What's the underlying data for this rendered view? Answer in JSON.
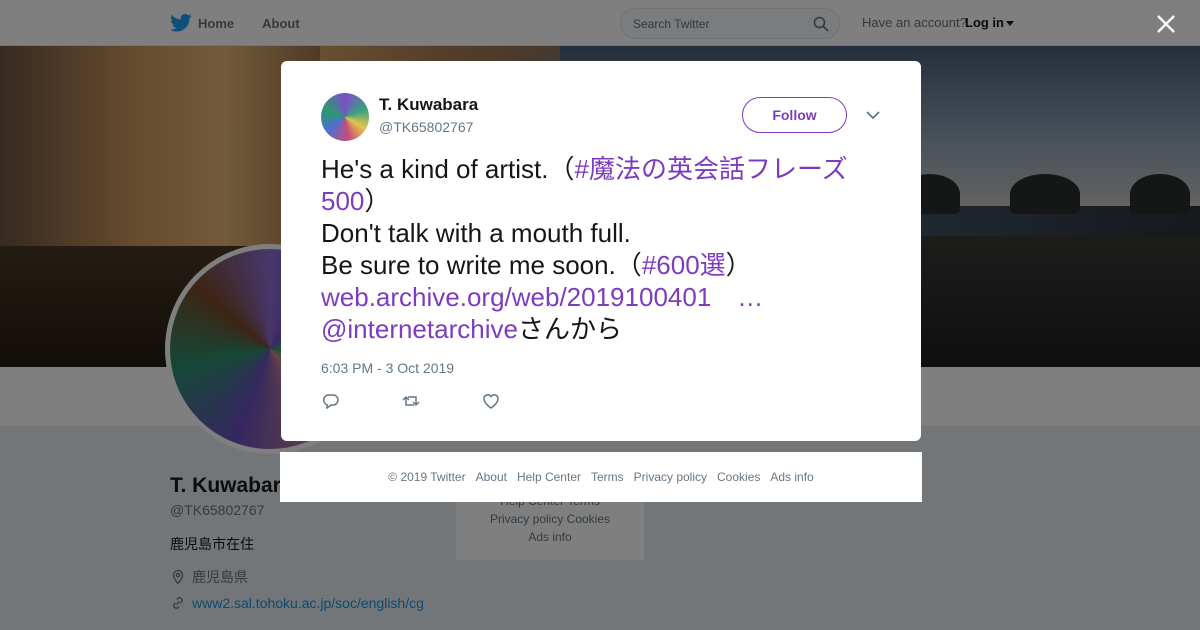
{
  "nav": {
    "home": "Home",
    "about": "About",
    "search_placeholder": "Search Twitter",
    "account_prompt": "Have an account?",
    "login": "Log in"
  },
  "profile": {
    "name": "T. Kuwabara",
    "handle": "@TK65802767",
    "bio": "鹿児島市在住",
    "location": "鹿児島県",
    "link": "www2.sal.tohoku.ac.jp/soc/english/cg",
    "more": "..."
  },
  "mini_footer": {
    "line1": "Help Center   Terms",
    "line2": "Privacy policy   Cookies",
    "line3": "Ads info"
  },
  "tweet": {
    "name": "T. Kuwabara",
    "handle": "@TK65802767",
    "follow": "Follow",
    "line1_text": "He's a kind of artist.（",
    "line1_tag": "#魔法の英会話フレーズ500",
    "line1_end": "）",
    "line2": "Don't talk with a mouth full.",
    "line3_text": "Be sure to write me soon.（",
    "line3_tag": "#600選",
    "line3_end": "）",
    "line4_link": "web.archive.org/web/2019100401　…",
    "line5_mention": "@internetarchive",
    "line5_end": "さんから",
    "timestamp": "6:03 PM - 3 Oct 2019"
  },
  "footer": {
    "items": [
      "© 2019 Twitter",
      "About",
      "Help Center",
      "Terms",
      "Privacy policy",
      "Cookies",
      "Ads info"
    ]
  },
  "colors": {
    "accent": "#7d3cbf",
    "twitter_blue": "#1da1f2"
  }
}
